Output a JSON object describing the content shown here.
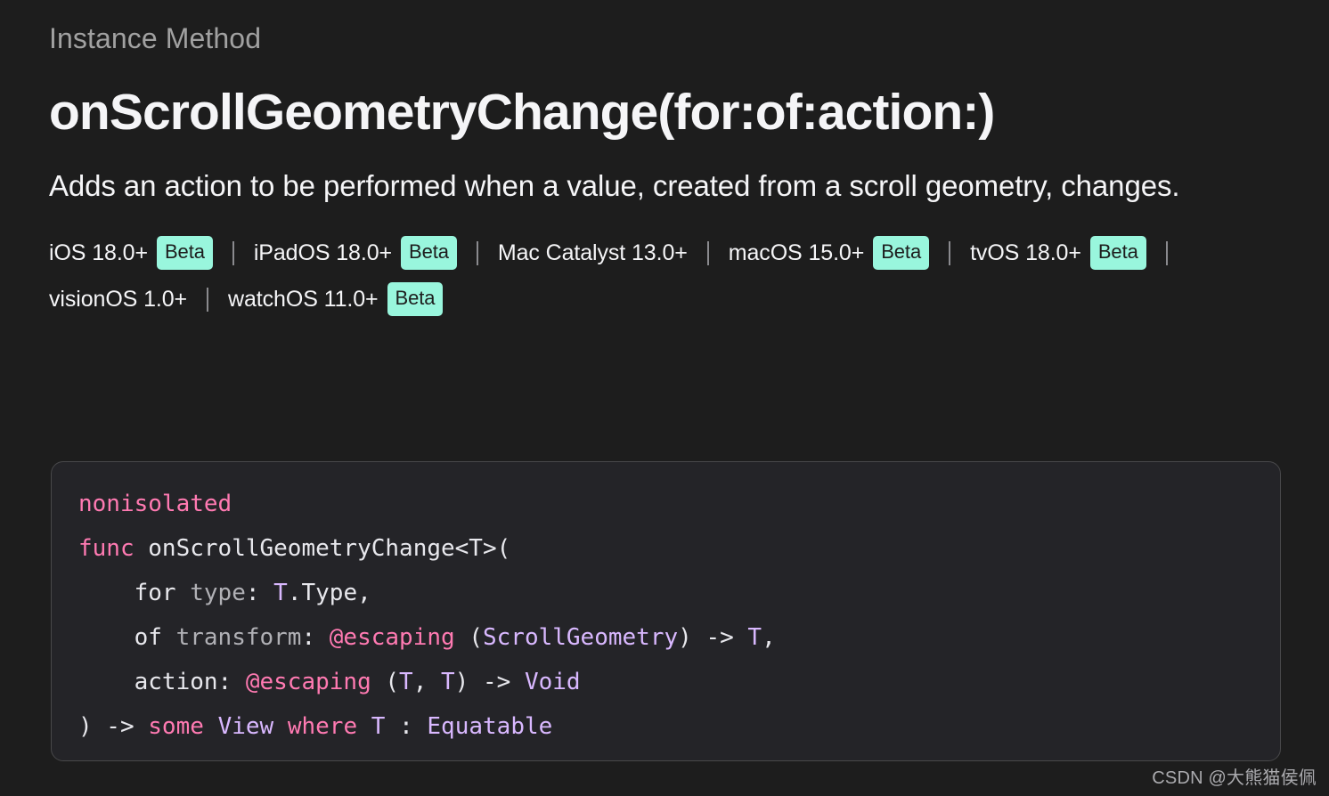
{
  "page": {
    "background_color": "#1d1d1d",
    "eyebrow": "Instance Method",
    "title": "onScrollGeometryChange(for:of:action:)",
    "abstract": "Adds an action to be performed when a value, created from a scroll geometry, changes."
  },
  "availability": {
    "beta_label": "Beta",
    "beta_badge_color": "#99f6dd",
    "separator": "|",
    "items": [
      {
        "platform": "iOS 18.0+",
        "beta": true
      },
      {
        "platform": "iPadOS 18.0+",
        "beta": true
      },
      {
        "platform": "Mac Catalyst 13.0+",
        "beta": false
      },
      {
        "platform": "macOS 15.0+",
        "beta": true
      },
      {
        "platform": "tvOS 18.0+",
        "beta": true
      },
      {
        "platform": "visionOS 1.0+",
        "beta": false
      },
      {
        "platform": "watchOS 11.0+",
        "beta": true
      }
    ]
  },
  "declaration": {
    "background_color": "#242428",
    "border_color": "#48484a",
    "keyword_color": "#ff7ab2",
    "type_color": "#d9b8ff",
    "param_color": "#b0b0b5",
    "text_color": "#e8e8ed",
    "lines": [
      [
        {
          "t": "nonisolated",
          "c": "kw"
        }
      ],
      [
        {
          "t": "func",
          "c": "kw"
        },
        {
          "t": " onScrollGeometryChange<T>(",
          "c": "plain"
        }
      ],
      [
        {
          "t": "    for ",
          "c": "plain"
        },
        {
          "t": "type",
          "c": "parm"
        },
        {
          "t": ": ",
          "c": "plain"
        },
        {
          "t": "T",
          "c": "type"
        },
        {
          "t": ".Type,",
          "c": "plain"
        }
      ],
      [
        {
          "t": "    of ",
          "c": "plain"
        },
        {
          "t": "transform",
          "c": "parm"
        },
        {
          "t": ": ",
          "c": "plain"
        },
        {
          "t": "@escaping",
          "c": "attr"
        },
        {
          "t": " (",
          "c": "plain"
        },
        {
          "t": "ScrollGeometry",
          "c": "type"
        },
        {
          "t": ") -> ",
          "c": "plain"
        },
        {
          "t": "T",
          "c": "type"
        },
        {
          "t": ",",
          "c": "plain"
        }
      ],
      [
        {
          "t": "    action: ",
          "c": "plain"
        },
        {
          "t": "@escaping",
          "c": "attr"
        },
        {
          "t": " (",
          "c": "plain"
        },
        {
          "t": "T",
          "c": "type"
        },
        {
          "t": ", ",
          "c": "plain"
        },
        {
          "t": "T",
          "c": "type"
        },
        {
          "t": ") -> ",
          "c": "plain"
        },
        {
          "t": "Void",
          "c": "type"
        }
      ],
      [
        {
          "t": ") -> ",
          "c": "plain"
        },
        {
          "t": "some",
          "c": "kw"
        },
        {
          "t": " ",
          "c": "plain"
        },
        {
          "t": "View",
          "c": "type"
        },
        {
          "t": " ",
          "c": "plain"
        },
        {
          "t": "where",
          "c": "kw"
        },
        {
          "t": " ",
          "c": "plain"
        },
        {
          "t": "T",
          "c": "type"
        },
        {
          "t": " : ",
          "c": "plain"
        },
        {
          "t": "Equatable",
          "c": "type"
        }
      ]
    ]
  },
  "watermark": {
    "text": "CSDN @大熊猫侯佩"
  }
}
